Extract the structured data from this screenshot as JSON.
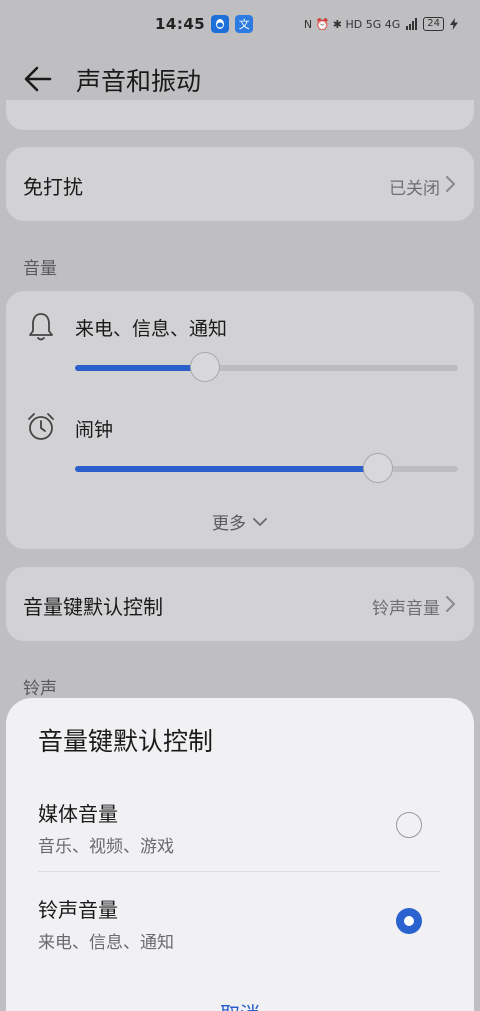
{
  "status_bar": {
    "time": "14:45",
    "app_badges": [
      "QQ",
      "文"
    ],
    "indicators": "N ⏰ ✱ HD 5G 4G",
    "battery": "24"
  },
  "header": {
    "title": "声音和振动"
  },
  "dnd": {
    "label": "免打扰",
    "value": "已关闭"
  },
  "volume": {
    "section_label": "音量",
    "calls": {
      "label": "来电、信息、通知",
      "level": 0.34
    },
    "alarm": {
      "label": "闹钟",
      "level": 0.79
    },
    "more_label": "更多"
  },
  "volume_key": {
    "label": "音量键默认控制",
    "value": "铃声音量"
  },
  "ringtone_section_label": "铃声",
  "sheet": {
    "title": "音量键默认控制",
    "options": [
      {
        "title": "媒体音量",
        "subtitle": "音乐、视频、游戏",
        "selected": false
      },
      {
        "title": "铃声音量",
        "subtitle": "来电、信息、通知",
        "selected": true
      }
    ],
    "cancel_label": "取消"
  },
  "colors": {
    "accent": "#2a5fcc",
    "scrim": "#bfbfc1",
    "card": "#d2d2d4",
    "sheet": "#f1f1f3"
  }
}
